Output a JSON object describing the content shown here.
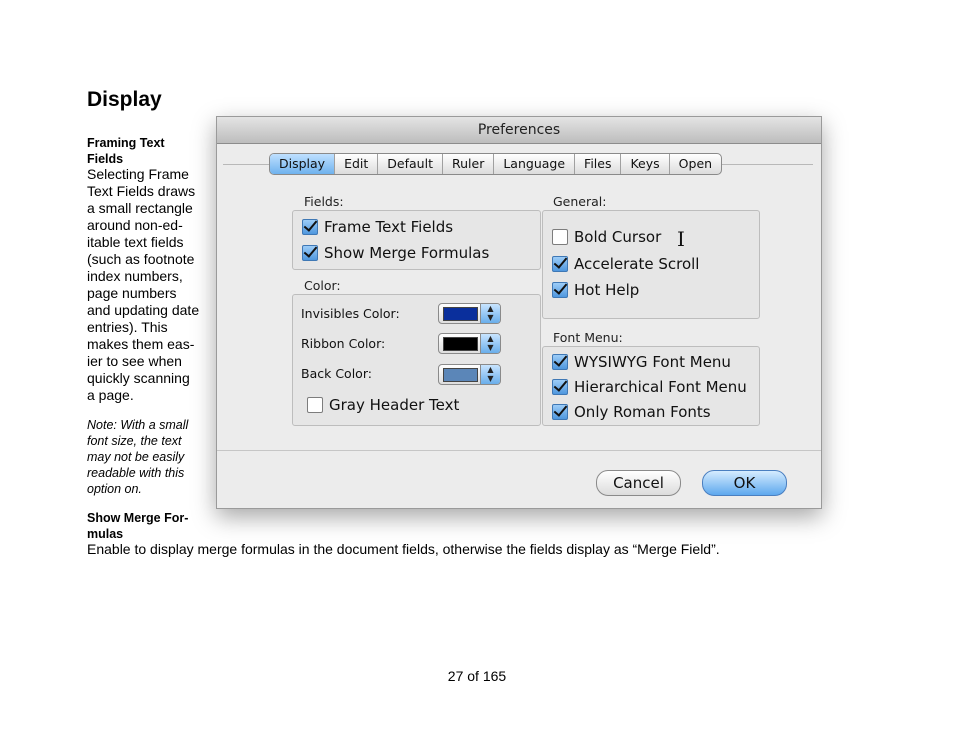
{
  "doc": {
    "title": "Display",
    "framing_heading_l1": "Framing Text",
    "framing_heading_l2": "Fields",
    "framing_body": [
      "Selecting Frame",
      "Text Fields draws",
      "a small rectangle",
      "around non-ed-",
      "itable text fields",
      "(such as footnote",
      "index numbers,",
      "page numbers",
      "and updating date",
      "entries). This",
      "makes them eas-",
      "ier to see when",
      "quickly scanning",
      "a page."
    ],
    "note": [
      "Note: With a small",
      "font size, the text",
      "may not be easily",
      "readable with this",
      "option on."
    ],
    "merge_heading_l1": "Show Merge For-",
    "merge_heading_l2": "mulas",
    "merge_desc": "Enable to display merge formulas in the document fields, otherwise the fields display as “Merge Field”.",
    "page_number": "27 of 165"
  },
  "dialog": {
    "title": "Preferences",
    "tabs": [
      "Display",
      "Edit",
      "Default",
      "Ruler",
      "Language",
      "Files",
      "Keys",
      "Open"
    ],
    "active_tab": "Display",
    "fields_label": "Fields:",
    "fields": [
      {
        "label": "Frame Text Fields",
        "checked": true
      },
      {
        "label": "Show Merge Formulas",
        "checked": true
      }
    ],
    "color_label": "Color:",
    "colors": [
      {
        "label": "Invisibles Color:",
        "swatch": "#0a2f9c"
      },
      {
        "label": "Ribbon Color:",
        "swatch": "#000000"
      },
      {
        "label": "Back Color:",
        "swatch": "#5b86b8"
      }
    ],
    "gray_header": {
      "label": "Gray Header Text",
      "checked": false
    },
    "general_label": "General:",
    "general": [
      {
        "label": "Bold Cursor",
        "checked": false
      },
      {
        "label": "Accelerate Scroll",
        "checked": true
      },
      {
        "label": "Hot Help",
        "checked": true
      }
    ],
    "font_menu_label": "Font Menu:",
    "font_menu": [
      {
        "label": "WYSIWYG Font Menu",
        "checked": true
      },
      {
        "label": "Hierarchical Font Menu",
        "checked": true
      },
      {
        "label": "Only Roman Fonts",
        "checked": true
      }
    ],
    "cancel_label": "Cancel",
    "ok_label": "OK"
  }
}
